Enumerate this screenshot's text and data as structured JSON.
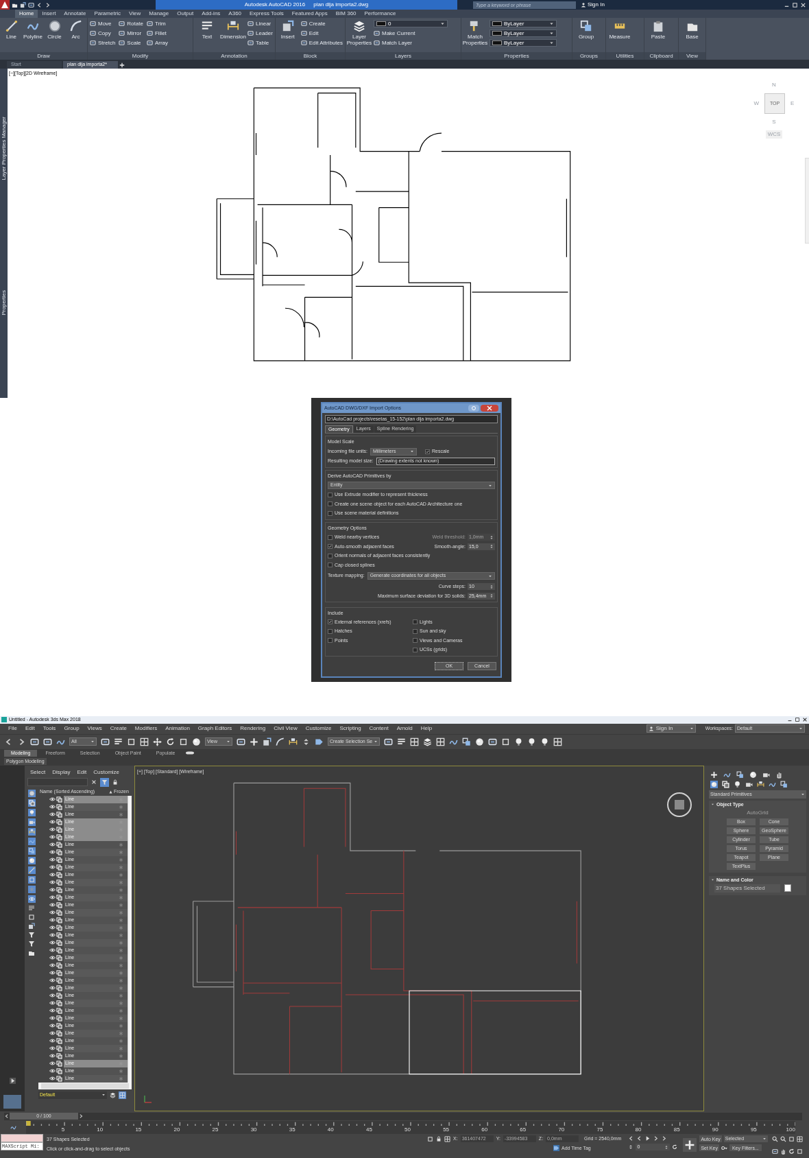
{
  "autocad": {
    "title": "Autodesk AutoCAD 2016",
    "file_name": "plan dlja importa2.dwg",
    "search": {
      "placeholder": "Type a keyword or phrase"
    },
    "sign_in": "Sign In",
    "tabs": [
      {
        "label": "Home",
        "selected": true
      },
      {
        "label": "Insert",
        "selected": false
      },
      {
        "label": "Annotate",
        "selected": false
      },
      {
        "label": "Parametric",
        "selected": false
      },
      {
        "label": "View",
        "selected": false
      },
      {
        "label": "Manage",
        "selected": false
      },
      {
        "label": "Output",
        "selected": false
      },
      {
        "label": "Add-ins",
        "selected": false
      },
      {
        "label": "A360",
        "selected": false
      },
      {
        "label": "Express Tools",
        "selected": false
      },
      {
        "label": "Featured Apps",
        "selected": false
      },
      {
        "label": "BIM 360",
        "selected": false
      },
      {
        "label": "Performance",
        "selected": false
      }
    ],
    "panels": [
      {
        "title": "Draw",
        "big": [
          "Line",
          "Polyline",
          "Circle",
          "Arc"
        ]
      },
      {
        "title": "Modify",
        "small": [
          {
            "label": "Move",
            "kind": "button"
          },
          {
            "label": "Copy",
            "kind": "button"
          },
          {
            "label": "Stretch",
            "kind": "button"
          },
          {
            "label": "Rotate",
            "kind": "button"
          },
          {
            "label": "Mirror",
            "kind": "button"
          },
          {
            "label": "Scale",
            "kind": "button"
          },
          {
            "label": "Trim",
            "kind": "button"
          },
          {
            "label": "Fillet",
            "kind": "button"
          },
          {
            "label": "Array",
            "kind": "button"
          }
        ]
      },
      {
        "title": "Annotation",
        "big": [
          "Text",
          "Dimension"
        ],
        "small": [
          {
            "label": "Linear",
            "kind": "button"
          },
          {
            "label": "Leader",
            "kind": "button"
          },
          {
            "label": "Table",
            "kind": "button"
          }
        ]
      },
      {
        "title": "Block",
        "big": [
          "Insert"
        ],
        "small": [
          {
            "label": "Create",
            "kind": "button"
          },
          {
            "label": "Edit",
            "kind": "button"
          },
          {
            "label": "Edit Attributes",
            "kind": "button"
          }
        ]
      },
      {
        "title": "Layers",
        "big": [
          "Layer Properties"
        ],
        "small": [
          {
            "label": "0",
            "kind": "dropdown"
          },
          {
            "label": "Make Current",
            "kind": "button"
          },
          {
            "label": "Match Layer",
            "kind": "button"
          }
        ]
      },
      {
        "title": "Properties",
        "big": [
          "Match Properties"
        ],
        "small": [
          {
            "label": "ByLayer",
            "kind": "dropdown"
          },
          {
            "label": "ByLayer",
            "kind": "dropdown"
          },
          {
            "label": "ByLayer",
            "kind": "dropdown"
          }
        ]
      },
      {
        "title": "Groups",
        "big": [
          "Group"
        ]
      },
      {
        "title": "Utilities",
        "big": [
          "Measure"
        ]
      },
      {
        "title": "Clipboard",
        "big": [
          "Paste"
        ]
      },
      {
        "title": "View",
        "big": [
          "Base"
        ]
      }
    ],
    "doc_tabs": [
      {
        "label": "Start",
        "selected": false
      },
      {
        "label": "plan dlja importa2*",
        "selected": true
      }
    ],
    "viewport_label": "[−][Top][2D Wireframe]",
    "side_labels": [
      "Layer Properties Manager",
      "Properties"
    ],
    "viewcube": {
      "north": "N",
      "west": "W",
      "face": "TOP",
      "east": "E",
      "south": "S",
      "ucs": "WCS"
    }
  },
  "import_dialog": {
    "title": "AutoCAD DWG/DXF Import Options",
    "path": "D:\\AutoCad projects\\resetas_15-152\\plan dlja importa2.dwg",
    "tabs": [
      {
        "label": "Geometry",
        "selected": true
      },
      {
        "label": "Layers",
        "selected": false
      },
      {
        "label": "Spline Rendering",
        "selected": false
      }
    ],
    "model_scale": {
      "heading": "Model Scale",
      "units_label": "Incoming file units:",
      "units_value": "Millimeters",
      "rescale": {
        "label": "Rescale",
        "checked": true
      },
      "size_label": "Resulting model size:",
      "size_value": "(Drawing extents not known)"
    },
    "derive": {
      "heading": "Derive AutoCAD Primitives by",
      "value": "Entity",
      "options": [
        {
          "label": "Use Extrude modifier to represent thickness",
          "checked": false
        },
        {
          "label": "Create one scene object for each AutoCAD Architecture one",
          "checked": false
        },
        {
          "label": "Use scene material definitions",
          "checked": false
        }
      ]
    },
    "geometry_options": {
      "heading": "Geometry Options",
      "options": [
        {
          "label": "Weld nearby vertices",
          "checked": false,
          "param_label": "Weld threshold:",
          "param_value": "1,0mm",
          "param_disabled": true
        },
        {
          "label": "Auto-smooth adjacent faces",
          "checked": true,
          "param_label": "Smooth-angle:",
          "param_value": "15,0",
          "param_disabled": false
        },
        {
          "label": "Orient normals of adjacent faces consistently",
          "checked": false
        },
        {
          "label": "Cap closed splines",
          "checked": false
        }
      ]
    },
    "texture_label": "Texture mapping:",
    "texture_value": "Generate coordinates for all objects",
    "curve_steps_label": "Curve steps:",
    "curve_steps_value": "10",
    "deviation_label": "Maximum surface deviation for 3D solids:",
    "deviation_value": "25,4mm",
    "include": {
      "heading": "Include",
      "left": [
        {
          "label": "External references (xrefs)",
          "checked": true
        },
        {
          "label": "Hatches",
          "checked": false
        },
        {
          "label": "Points",
          "checked": false
        }
      ],
      "right": [
        {
          "label": "Lights",
          "checked": false
        },
        {
          "label": "Sun and sky",
          "checked": false
        },
        {
          "label": "Views and Cameras",
          "checked": false
        },
        {
          "label": "UCSs (grids)",
          "checked": false
        }
      ]
    },
    "buttons": [
      "OK",
      "Cancel"
    ]
  },
  "max": {
    "title": "Untitled - Autodesk 3ds Max 2018",
    "menu": [
      "File",
      "Edit",
      "Tools",
      "Group",
      "Views",
      "Create",
      "Modifiers",
      "Animation",
      "Graph Editors",
      "Rendering",
      "Civil View",
      "Customize",
      "Scripting",
      "Content",
      "Arnold",
      "Help"
    ],
    "sign_in": "Sign In",
    "workspaces_label": "Workspaces:",
    "workspace": "Default",
    "toolbar_dropdowns": [
      "All",
      "View",
      "Create Selection Se"
    ],
    "ribbon_tabs": [
      {
        "label": "Modeling",
        "selected": true
      },
      {
        "label": "Freeform",
        "selected": false
      },
      {
        "label": "Selection",
        "selected": false
      },
      {
        "label": "Object Paint",
        "selected": false
      },
      {
        "label": "Populate",
        "selected": false
      }
    ],
    "ribbon_panel": "Polygon Modeling",
    "explorer": {
      "menu": [
        "Select",
        "Display",
        "Edit",
        "Customize"
      ],
      "columns": [
        "Name (Sorted Ascending)",
        "Frozen"
      ],
      "rows": [
        {
          "name": "Line",
          "selected": true
        },
        {
          "name": "Line",
          "selected": false
        },
        {
          "name": "Line",
          "selected": false
        },
        {
          "name": "Line",
          "selected": true
        },
        {
          "name": "Line",
          "selected": true
        },
        {
          "name": "Line",
          "selected": true
        },
        {
          "name": "Line",
          "selected": false
        },
        {
          "name": "Line",
          "selected": false
        },
        {
          "name": "Line",
          "selected": false
        },
        {
          "name": "Line",
          "selected": false
        },
        {
          "name": "Line",
          "selected": false
        },
        {
          "name": "Line",
          "selected": false
        },
        {
          "name": "Line",
          "selected": false
        },
        {
          "name": "Line",
          "selected": false
        },
        {
          "name": "Line",
          "selected": false
        },
        {
          "name": "Line",
          "selected": false
        },
        {
          "name": "Line",
          "selected": false
        },
        {
          "name": "Line",
          "selected": false
        },
        {
          "name": "Line",
          "selected": false
        },
        {
          "name": "Line",
          "selected": false
        },
        {
          "name": "Line",
          "selected": false
        },
        {
          "name": "Line",
          "selected": false
        },
        {
          "name": "Line",
          "selected": false
        },
        {
          "name": "Line",
          "selected": false
        },
        {
          "name": "Line",
          "selected": false
        },
        {
          "name": "Line",
          "selected": false
        },
        {
          "name": "Line",
          "selected": false
        },
        {
          "name": "Line",
          "selected": false
        },
        {
          "name": "Line",
          "selected": false
        },
        {
          "name": "Line",
          "selected": false
        },
        {
          "name": "Line",
          "selected": false
        },
        {
          "name": "Line",
          "selected": false
        },
        {
          "name": "Line",
          "selected": false
        },
        {
          "name": "Line",
          "selected": false
        },
        {
          "name": "Line",
          "selected": false
        },
        {
          "name": "Line",
          "selected": true
        },
        {
          "name": "Line",
          "selected": false
        },
        {
          "name": "Line",
          "selected": false
        }
      ],
      "layer": "Default"
    },
    "viewport_label": "[+] [Top] [Standard] [Wireframe]",
    "command_panel": {
      "category": "Standard Primitives",
      "object_type": {
        "heading": "Object Type",
        "autogrid": "AutoGrid",
        "buttons": [
          "Box",
          "Cone",
          "Sphere",
          "GeoSphere",
          "Cylinder",
          "Tube",
          "Torus",
          "Pyramid",
          "Teapot",
          "Plane",
          "TextPlus"
        ]
      },
      "name_color": {
        "heading": "Name and Color",
        "value": "37 Shapes Selected"
      }
    },
    "time_slider": "0 / 100",
    "ruler": [
      "5",
      "10",
      "15",
      "20",
      "25",
      "30",
      "35",
      "40",
      "45",
      "50",
      "55",
      "60",
      "65",
      "70",
      "75",
      "80",
      "85",
      "90",
      "95",
      "100"
    ],
    "status": {
      "maxscript": "MAXScript Mi:",
      "selection": "37 Shapes Selected",
      "prompt": "Click or click-and-drag to select objects",
      "coords": [
        {
          "label": "X:",
          "value": "361407472"
        },
        {
          "label": "Y:",
          "value": "-33994583"
        },
        {
          "label": "Z:",
          "value": "0,0mm"
        }
      ],
      "grid": "Grid = 2540,0mm",
      "add_time_tag": "Add Time Tag",
      "auto_key": "Auto Key",
      "key_mode": "Selected",
      "set_key": "Set Key",
      "key_filters": "Key Filters...",
      "frame": "0"
    }
  }
}
